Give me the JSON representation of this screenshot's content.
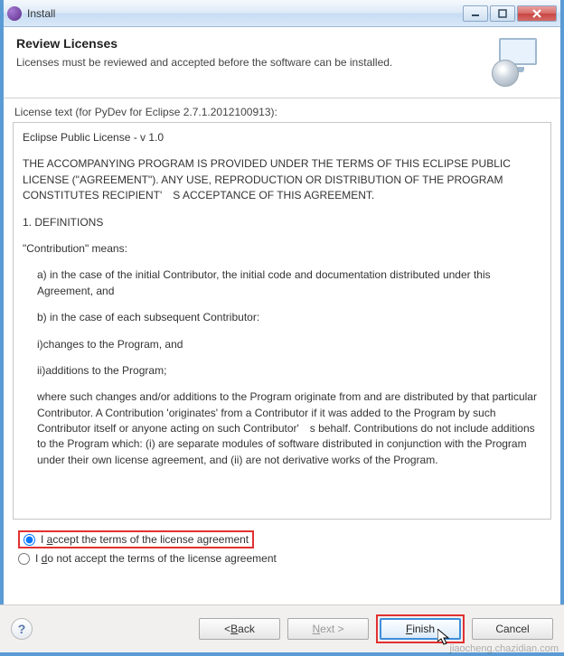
{
  "window": {
    "title": "Install"
  },
  "header": {
    "title": "Review Licenses",
    "subtitle": "Licenses must be reviewed and accepted before the software can be installed."
  },
  "license": {
    "groupbox_label": "License text (for PyDev for Eclipse 2.7.1.2012100913):",
    "title_line": "Eclipse Public License - v 1.0",
    "para_terms": "THE ACCOMPANYING PROGRAM IS PROVIDED UNDER THE TERMS OF THIS ECLIPSE PUBLIC LICENSE (\"AGREEMENT\"). ANY USE, REPRODUCTION OR DISTRIBUTION OF THE PROGRAM CONSTITUTES RECIPIENT' S ACCEPTANCE OF THIS AGREEMENT.",
    "definitions_heading": "1. DEFINITIONS",
    "contribution_means": "\"Contribution\" means:",
    "def_a": "a) in the case of the initial Contributor, the initial code and documentation distributed under this Agreement, and",
    "def_b": "b) in the case of each subsequent Contributor:",
    "def_i": "i)changes to the Program, and",
    "def_ii": "ii)additions to the Program;",
    "originates": "where such changes and/or additions to the Program originate from and are distributed by that particular Contributor. A Contribution 'originates' from a Contributor if it was added to the Program by such Contributor itself or anyone acting on such Contributor' s behalf. Contributions do not include additions to the Program which: (i) are separate modules of software distributed in conjunction with the Program under their own license agreement, and (ii) are not derivative works of the Program."
  },
  "radios": {
    "accept_pre": "I ",
    "accept_mn": "a",
    "accept_post": "ccept the terms of the license agreement",
    "reject_pre": "I ",
    "reject_mn": "d",
    "reject_post": "o not accept the terms of the license agreement",
    "selected": "accept"
  },
  "buttons": {
    "back_pre": "< ",
    "back_mn": "B",
    "back_post": "ack",
    "next_mn": "N",
    "next_post": "ext >",
    "finish_mn": "F",
    "finish_post": "inish",
    "cancel": "Cancel"
  },
  "watermark": "jiaocheng.chazidian.com"
}
